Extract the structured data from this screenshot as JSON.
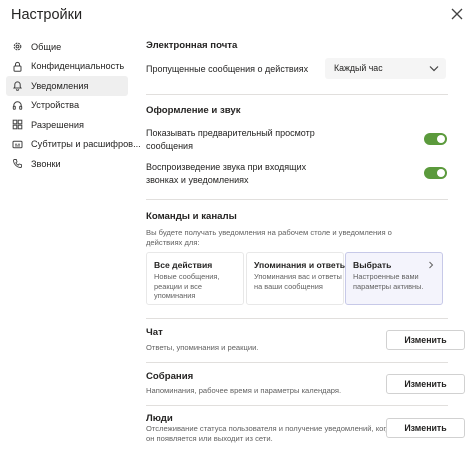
{
  "header": {
    "title": "Настройки"
  },
  "sidebar": {
    "items": [
      {
        "label": "Общие",
        "icon": "gear-icon"
      },
      {
        "label": "Конфиденциальность",
        "icon": "lock-icon"
      },
      {
        "label": "Уведомления",
        "icon": "bell-icon",
        "active": true
      },
      {
        "label": "Устройства",
        "icon": "headset-icon"
      },
      {
        "label": "Разрешения",
        "icon": "grid-icon"
      },
      {
        "label": "Субтитры и расшифров...",
        "icon": "captions-icon"
      },
      {
        "label": "Звонки",
        "icon": "phone-icon"
      }
    ]
  },
  "email": {
    "title": "Электронная почта",
    "missed_label": "Пропущенные сообщения о действиях",
    "missed_value": "Каждый час"
  },
  "appearance": {
    "title": "Оформление и звук",
    "preview_label_1": "Показывать предварительный просмотр",
    "preview_label_2": "сообщения",
    "preview_on": true,
    "sound_label_1": "Воспроизведение звука при входящих",
    "sound_label_2": "звонках и уведомлениях",
    "sound_on": true
  },
  "teams": {
    "title": "Команды и каналы",
    "desc_1": "Вы будете получать уведомления на рабочем столе и уведомления о",
    "desc_2": "действиях для:",
    "cards": [
      {
        "title": "Все действия",
        "desc_1": "Новые сообщения,",
        "desc_2": "реакции и все",
        "desc_3": "упоминания"
      },
      {
        "title": "Упоминания и ответы",
        "desc_1": "Упоминания вас и ответы",
        "desc_2": "на ваши сообщения"
      },
      {
        "title": "Выбрать",
        "desc_1": "Настроенные вами",
        "desc_2": "параметры активны."
      }
    ]
  },
  "chat": {
    "title": "Чат",
    "desc": "Ответы, упоминания и реакции.",
    "button": "Изменить"
  },
  "meetings": {
    "title": "Собрания",
    "desc": "Напоминания, рабочее время и параметры календаря.",
    "button": "Изменить"
  },
  "people": {
    "title": "Люди",
    "desc_1": "Отслеживание статуса пользователя и получение уведомлений, когда",
    "desc_2": "он появляется или выходит из сети.",
    "button": "Изменить"
  },
  "colors": {
    "accent": "#5b9a3c",
    "selected_card": "#f4f4fc",
    "active_nav": "#efefef"
  }
}
